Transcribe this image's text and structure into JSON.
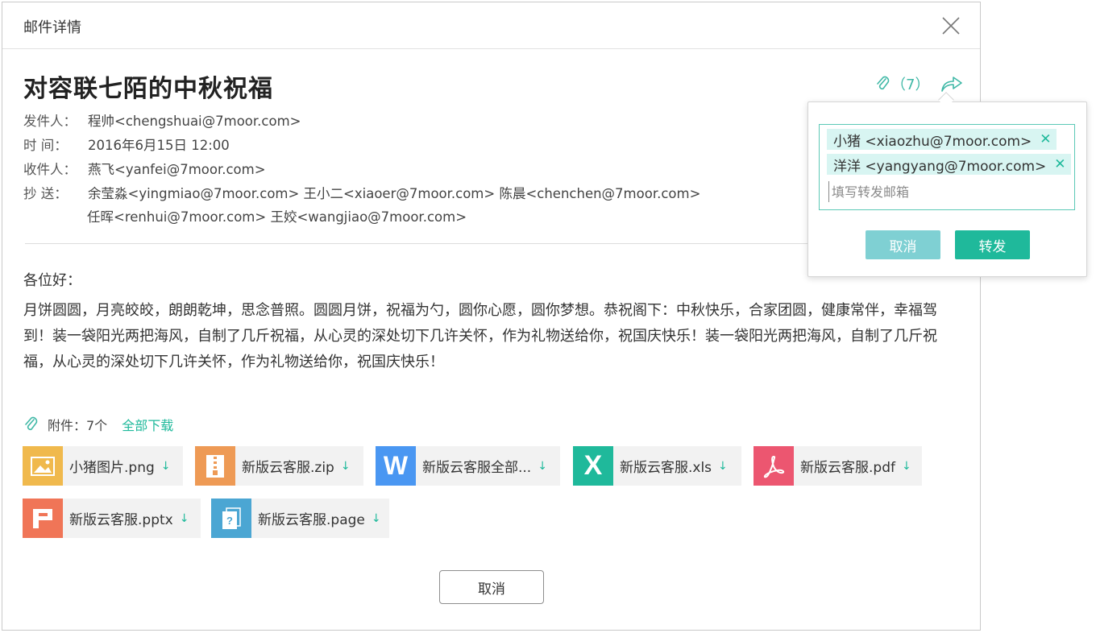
{
  "dialog": {
    "title": "邮件详情"
  },
  "email": {
    "subject": "对容联七陌的中秋祝福",
    "attachment_count_label": "（7）",
    "sender_label": "发件人：",
    "sender": "程帅<chengshuai@7moor.com>",
    "time_label": "时 间：",
    "time": "2016年6月15日  12:00",
    "recipient_label": "收件人：",
    "recipient": "燕飞<yanfei@7moor.com>",
    "cc_label": "抄 送：",
    "cc_line1": "余莹淼<yingmiao@7moor.com>  王小二<xiaoer@7moor.com>  陈晨<chenchen@7moor.com>",
    "cc_line2": "任晖<renhui@7moor.com>  王姣<wangjiao@7moor.com>",
    "greeting": "各位好：",
    "body": "月饼圆圆，月亮皎皎，朗朗乾坤，思念普照。圆圆月饼，祝福为勺，圆你心愿，圆你梦想。恭祝阁下：中秋快乐，合家团圆，健康常伴，幸福驾到！装一袋阳光两把海风，自制了几斤祝福，从心灵的深处切下几许关怀，作为礼物送给你，祝国庆快乐！装一袋阳光两把海风，自制了几斤祝福，从心灵的深处切下几许关怀，作为礼物送给你，祝国庆快乐！"
  },
  "attachments": {
    "label": "附件：7个",
    "download_all": "全部下载",
    "files": [
      {
        "name": "小猪图片.png",
        "icon": "image-icon",
        "color": "#f0b94d"
      },
      {
        "name": "新版云客服.zip",
        "icon": "zip-icon",
        "color": "#ee9a55"
      },
      {
        "name": "新版云客服全部...",
        "icon": "word-icon",
        "color": "#4a97f2"
      },
      {
        "name": "新版云客服.xls",
        "icon": "excel-icon",
        "color": "#1fb99b"
      },
      {
        "name": "新版云客服.pdf",
        "icon": "pdf-icon",
        "color": "#ec5670"
      },
      {
        "name": "新版云客服.pptx",
        "icon": "ppt-icon",
        "color": "#f07557"
      },
      {
        "name": "新版云客服.page",
        "icon": "page-icon",
        "color": "#4ba6d3"
      }
    ],
    "download_glyph": "↓"
  },
  "footer": {
    "cancel_label": "取消"
  },
  "forward_popover": {
    "recipients": [
      {
        "label": "小猪 <xiaozhu@7moor.com>"
      },
      {
        "label": "洋洋 <yangyang@7moor.com>"
      }
    ],
    "remove_glyph": "✕",
    "input_placeholder": "填写转发邮箱",
    "cancel_label": "取消",
    "forward_label": "转发"
  }
}
